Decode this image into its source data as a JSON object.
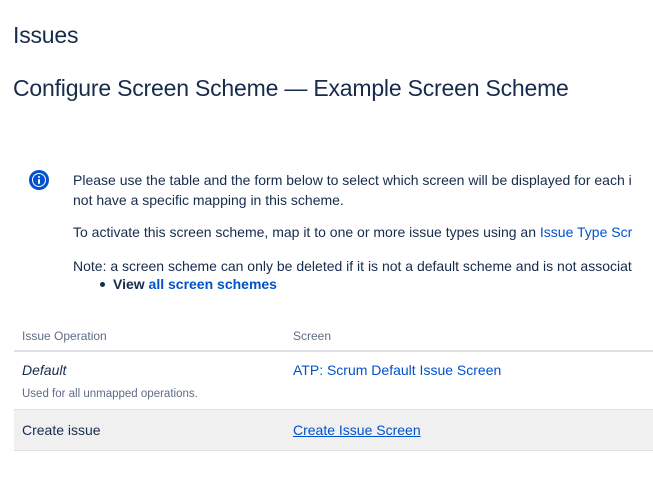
{
  "page": {
    "section_title": "Issues",
    "title": "Configure Screen Scheme — Example Screen Scheme"
  },
  "info": {
    "icon": "info-icon",
    "line1": "Please use the table and the form below to select which screen will be displayed for each i",
    "line2": "not have a specific mapping in this scheme.",
    "activate_text": "To activate this screen scheme, map it to one or more issue types using an ",
    "activate_link": "Issue Type Scr",
    "note_text": "Note: a screen scheme can only be deleted if it is not a default scheme and is not associat",
    "view_label": "View",
    "view_link": "all screen schemes"
  },
  "table": {
    "headers": [
      "Issue Operation",
      "Screen"
    ],
    "rows": [
      {
        "operation": "Default",
        "operation_note": "Used for all unmapped operations.",
        "screen": "ATP: Scrum Default Issue Screen"
      },
      {
        "operation": "Create issue",
        "screen": "Create Issue Screen"
      }
    ]
  },
  "colors": {
    "text": "#172b4d",
    "link": "#0052cc",
    "muted": "#5e6c84",
    "row_highlight": "#f0f0f0",
    "border": "#dfe1e6"
  }
}
